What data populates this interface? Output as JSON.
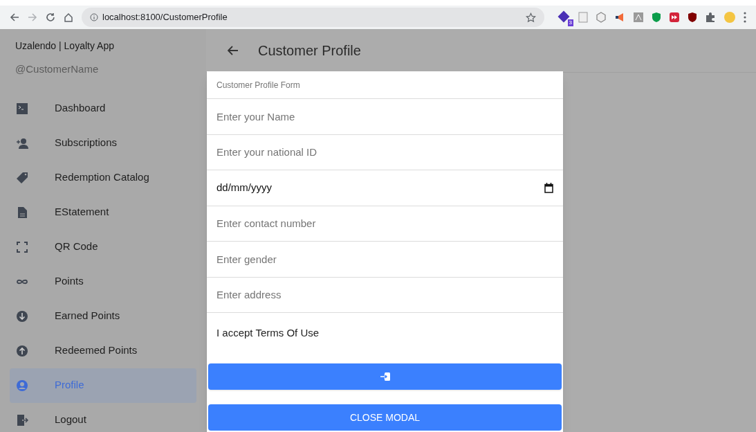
{
  "browser": {
    "url": "localhost:8100/CustomerProfile",
    "extension_badge": "3"
  },
  "sidebar": {
    "title": "Uzalendo | Loyalty App",
    "subtitle": "@CustomerName",
    "items": [
      {
        "label": "Dashboard",
        "selected": false
      },
      {
        "label": "Subscriptions",
        "selected": false
      },
      {
        "label": "Redemption Catalog",
        "selected": false
      },
      {
        "label": "EStatement",
        "selected": false
      },
      {
        "label": "QR Code",
        "selected": false
      },
      {
        "label": "Points",
        "selected": false
      },
      {
        "label": "Earned Points",
        "selected": false
      },
      {
        "label": "Redeemed Points",
        "selected": false
      },
      {
        "label": "Profile",
        "selected": true
      },
      {
        "label": "Logout",
        "selected": false
      }
    ]
  },
  "header": {
    "title": "Customer Profile"
  },
  "modal": {
    "title": "Customer Profile Form",
    "fields": [
      {
        "kind": "text",
        "placeholder": "Enter your Name"
      },
      {
        "kind": "text",
        "placeholder": "Enter your national ID"
      },
      {
        "kind": "date",
        "value": "dd/mm/yyyy"
      },
      {
        "kind": "text",
        "placeholder": "Enter contact number"
      },
      {
        "kind": "text",
        "placeholder": "Enter gender"
      },
      {
        "kind": "text",
        "placeholder": "Enter address"
      }
    ],
    "terms_label": "I accept Terms Of Use",
    "close_button": "CLOSE MODAL"
  }
}
